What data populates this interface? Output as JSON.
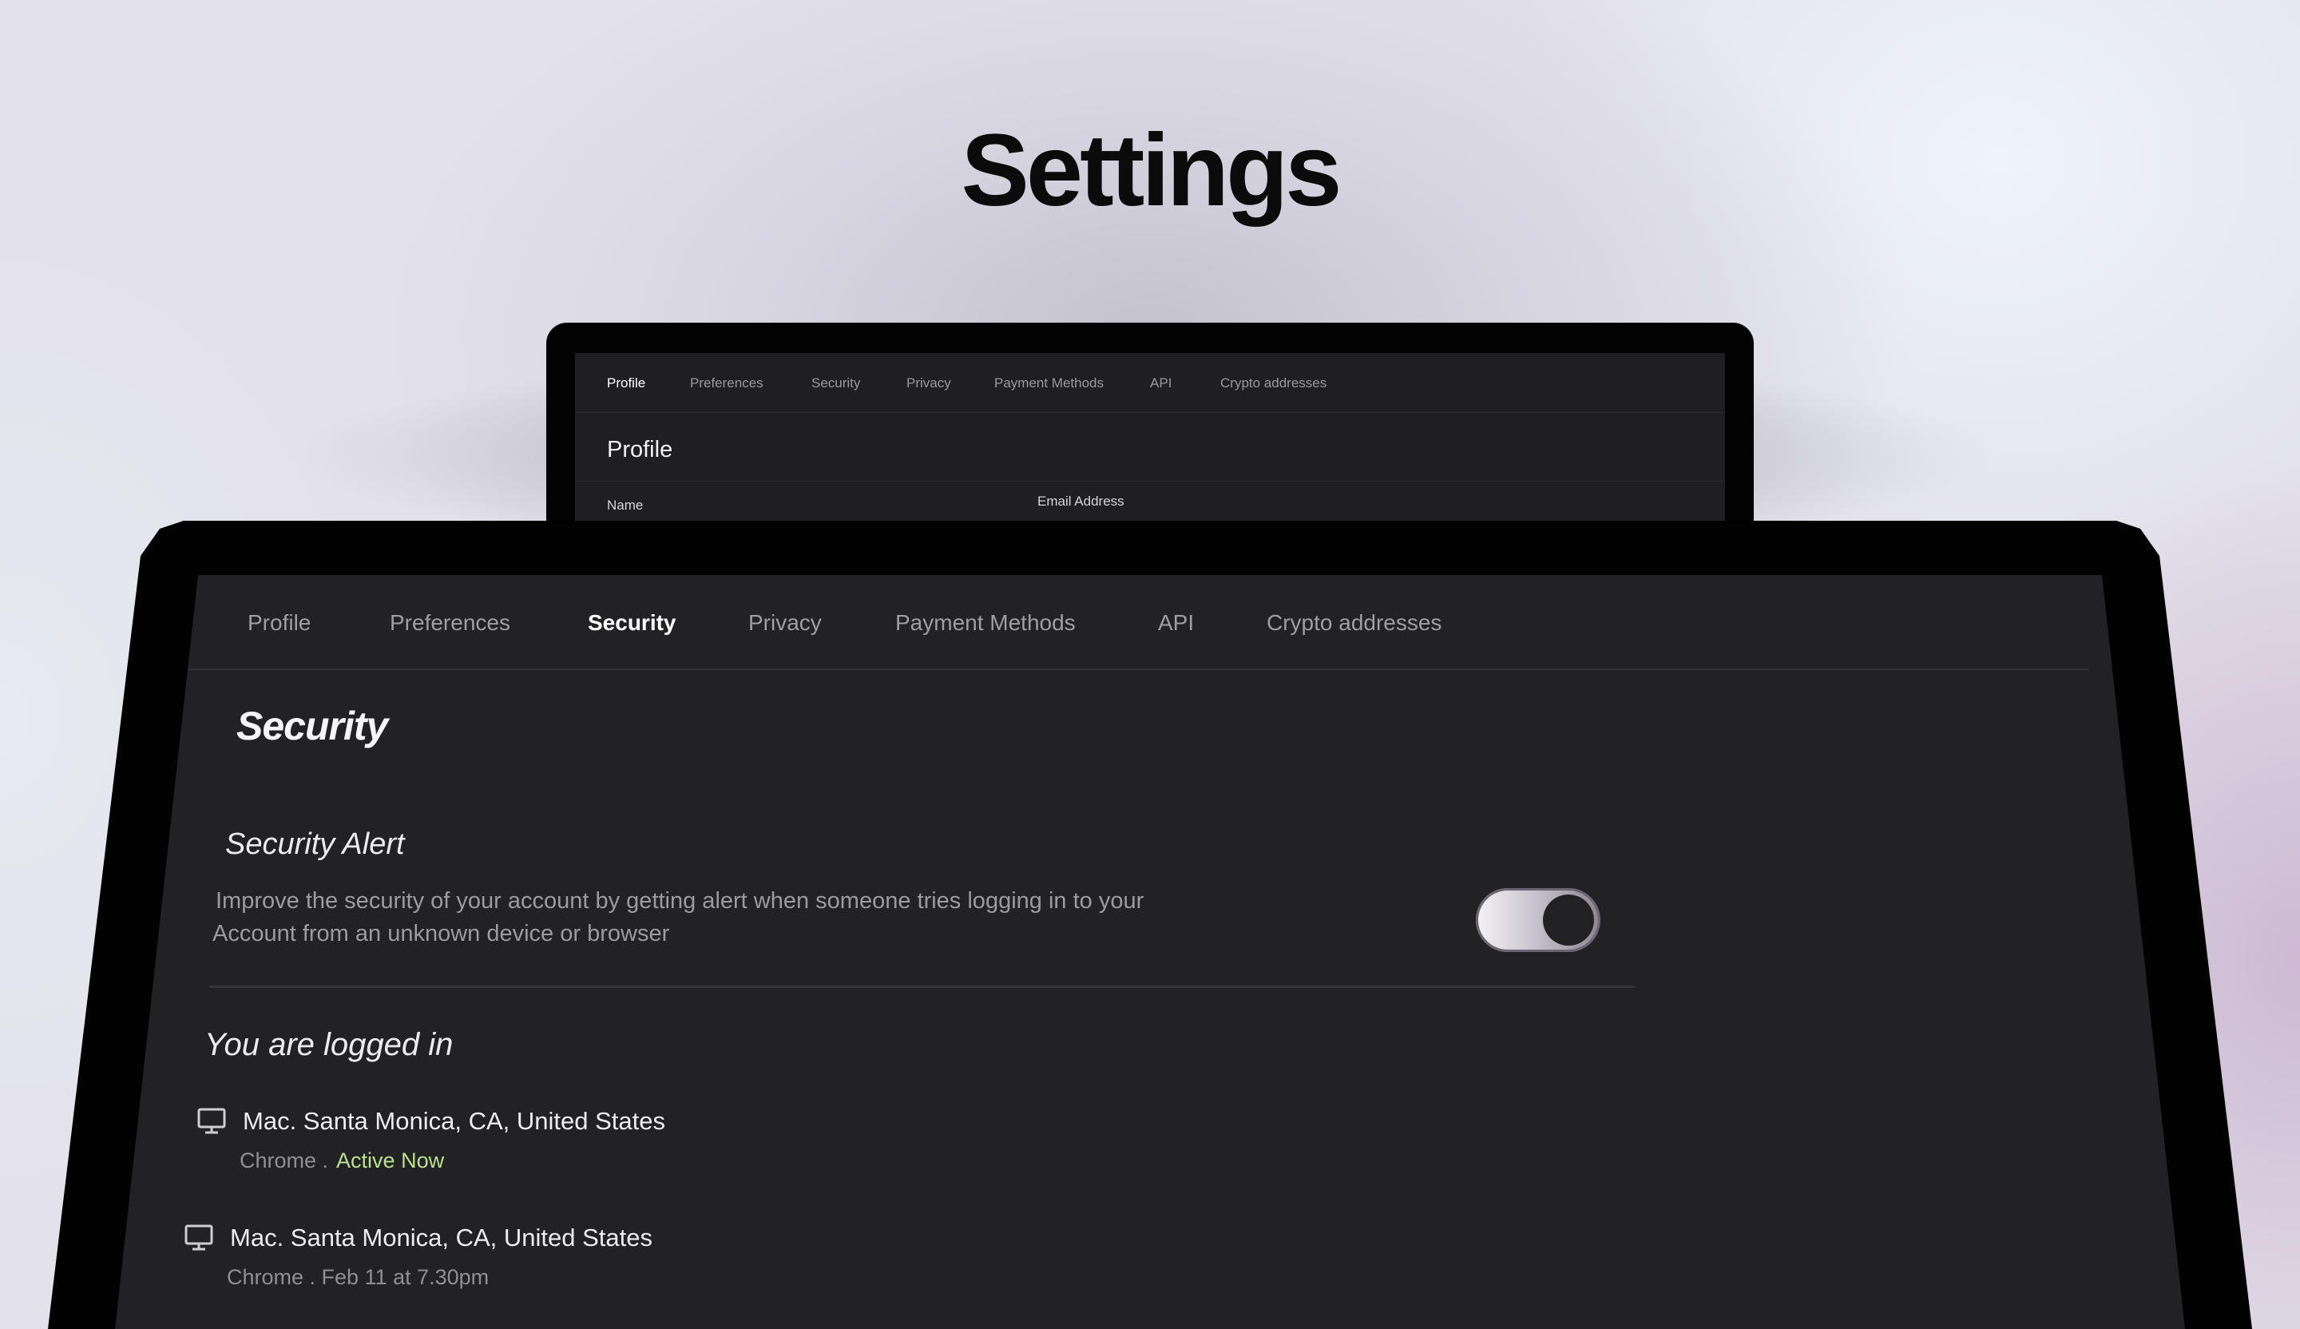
{
  "page": {
    "title": "Settings"
  },
  "back_window": {
    "tabs": [
      "Profile",
      "Preferences",
      "Security",
      "Privacy",
      "Payment Methods",
      "API",
      "Crypto addresses"
    ],
    "active_tab": "Profile",
    "heading": "Profile",
    "fields": {
      "name_label": "Name",
      "email_label": "Email Address"
    }
  },
  "front_window": {
    "tabs": [
      "Profile",
      "Preferences",
      "Security",
      "Privacy",
      "Payment Methods",
      "API",
      "Crypto addresses"
    ],
    "active_tab": "Security",
    "heading": "Security",
    "security_alert": {
      "title": "Security Alert",
      "description_line1": "Improve the security of your account by getting alert when someone tries logging in to your",
      "description_line2": "Account from an unknown device or browser",
      "toggle_on": true
    },
    "sessions": {
      "title": "You are logged in",
      "items": [
        {
          "device": "Mac. Santa Monica, CA, United States",
          "browser": "Chrome .",
          "status": "Active Now",
          "icon": "monitor-icon"
        },
        {
          "device": "Mac. Santa Monica, CA, United States",
          "browser": "Chrome . Feb 11 at 7.30pm",
          "status": "",
          "icon": "monitor-icon"
        }
      ]
    }
  },
  "colors": {
    "screen_bg": "#222225",
    "active_text": "#ffffff",
    "inactive_text": "#9e9ea3",
    "active_status": "#b8e08e"
  }
}
